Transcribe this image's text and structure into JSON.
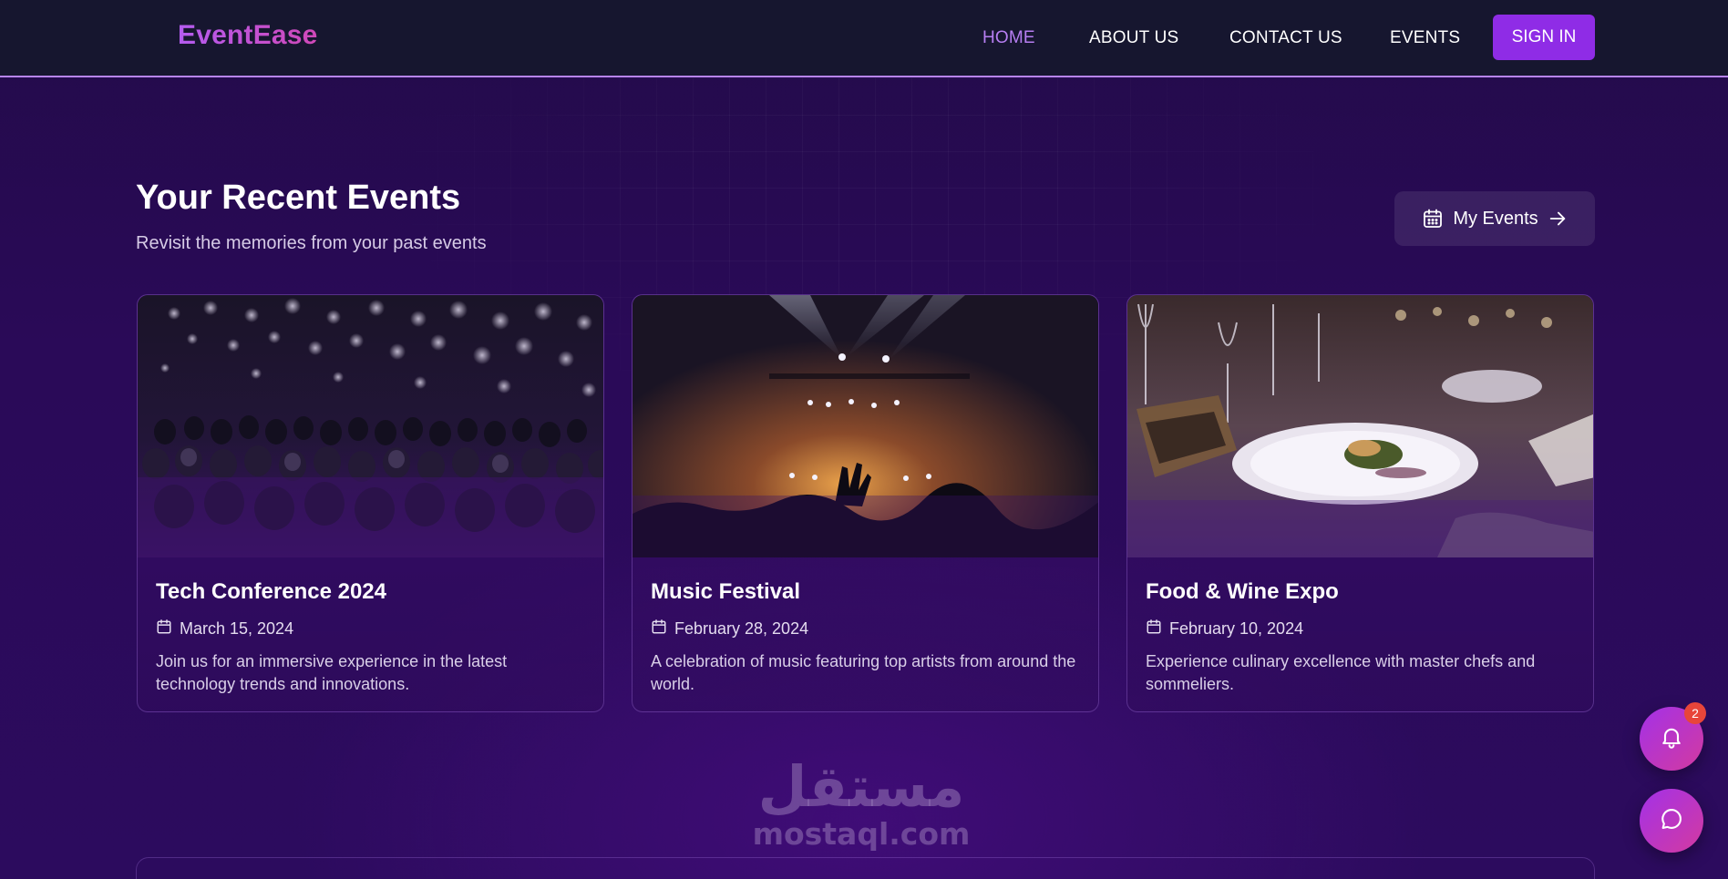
{
  "app": {
    "logo": "EventEase"
  },
  "nav": {
    "links": [
      {
        "label": "HOME",
        "active": true
      },
      {
        "label": "ABOUT US",
        "active": false
      },
      {
        "label": "CONTACT US",
        "active": false
      },
      {
        "label": "EVENTS",
        "active": false
      }
    ],
    "signin_label": "SIGN IN"
  },
  "section": {
    "title": "Your Recent Events",
    "subtitle": "Revisit the memories from your past events",
    "my_events_label": "My Events",
    "my_events_icon": "calendar-icon",
    "my_events_arrow_icon": "arrow-right-icon"
  },
  "events": [
    {
      "title": "Tech Conference 2024",
      "date": "March 15, 2024",
      "description": "Join us for an immersive experience in the latest technology trends and innovations.",
      "image": "conference-audience-photo"
    },
    {
      "title": "Music Festival",
      "date": "February 28, 2024",
      "description": "A celebration of music featuring top artists from around the world.",
      "image": "concert-crowd-photo"
    },
    {
      "title": "Food & Wine Expo",
      "date": "February 10, 2024",
      "description": "Experience culinary excellence with master chefs and sommeliers.",
      "image": "dining-table-photo"
    }
  ],
  "watermark": {
    "arabic": "مستقل",
    "latin": "mostaql.com"
  },
  "notifications": {
    "count": "2",
    "icon": "bell-icon"
  },
  "chat": {
    "icon": "chat-bubble-icon"
  },
  "colors": {
    "accent": "#8f2ce6",
    "nav_active": "#b77ef2",
    "background": "#2a0a58",
    "navbar": "#16162f",
    "badge": "#e8453a"
  }
}
